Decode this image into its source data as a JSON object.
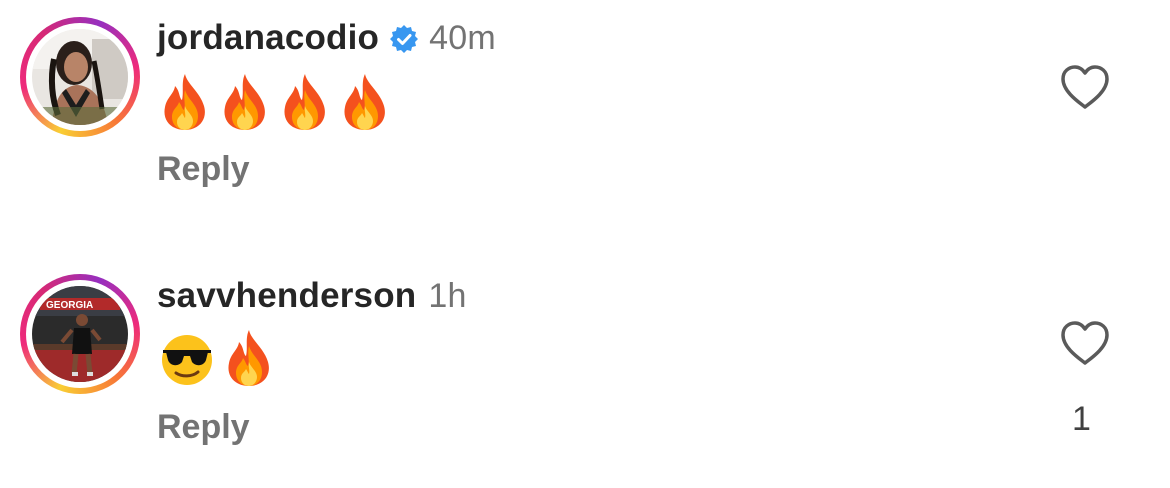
{
  "comments": [
    {
      "username": "jordanacodio",
      "verified": true,
      "time": "40m",
      "emojis": [
        "fire",
        "fire",
        "fire",
        "fire"
      ],
      "reply_label": "Reply",
      "likes": ""
    },
    {
      "username": "savvhenderson",
      "verified": false,
      "time": "1h",
      "emojis": [
        "smiling-face-with-sunglasses",
        "fire"
      ],
      "reply_label": "Reply",
      "likes": "1"
    }
  ],
  "colors": {
    "verified_blue": "#3897f0",
    "secondary_text": "#737373",
    "primary_text": "#262626"
  }
}
